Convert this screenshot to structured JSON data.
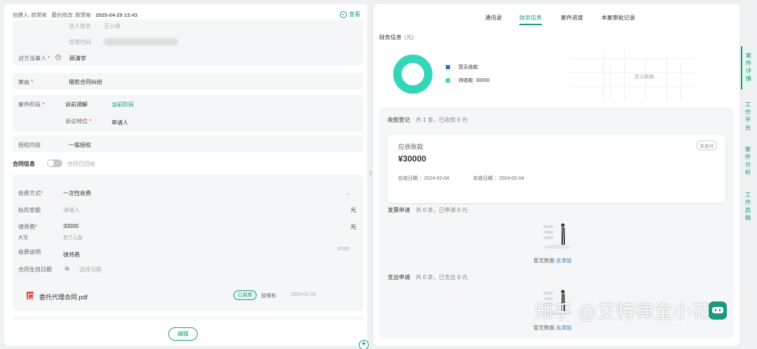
{
  "left": {
    "meta": {
      "creator_label": "创建人:",
      "creator": "欧荣彬",
      "modifier_label": "最后修改:",
      "modifier": "欧荣彬",
      "date": "2025-04-29 13:43"
    },
    "view_label": "查看",
    "fields": {
      "legal_person_label": "法人姓名",
      "legal_person_value": "王小侠",
      "credit_code_label": "信用代码",
      "counterparty_label": "对方当事人",
      "counterparty_value": "顾清宰",
      "cause_label": "案由",
      "cause_value": "借款合同纠纷",
      "stage_label": "案件阶段",
      "stage_value": "诉前调解",
      "stage_link": "当前阶段",
      "position_label": "诉讼地位",
      "position_value": "申请人",
      "auth_label": "授权内容",
      "auth_value": "一般授权"
    },
    "contract": {
      "title": "合同信息",
      "toggle_label": "合同已回收",
      "fee_method_label": "收费方式",
      "fee_method_value": "一次性收费",
      "target_amount_label": "标的金额",
      "target_amount_placeholder": "请输入",
      "unit": "元",
      "lawyer_fee_label": "律师费",
      "lawyer_fee_value": "30000",
      "uppercase_label": "大写",
      "uppercase_value": "叁万元整",
      "fee_note_label": "收费说明",
      "fee_note_value": "律师费",
      "char_count": "3/500",
      "effective_date_label": "合同生效日期",
      "effective_date_placeholder": "选择日期",
      "file_name": "委托代理合同.pdf",
      "file_tag": "已用章",
      "file_user": "欧荣彬",
      "file_date": "2024-01-09"
    },
    "edit_label": "编辑"
  },
  "right": {
    "tabs": [
      "通讯录",
      "财务信息",
      "案件进度",
      "本案审批记录"
    ],
    "active_tab": "财务信息",
    "finance_title": "财务信息",
    "finance_unit": "(元)",
    "legend": [
      {
        "label": "暂无收款",
        "value": "",
        "color": "#1f78c8"
      },
      {
        "label": "待收款",
        "value": "30000",
        "color": "#34d6b8"
      }
    ],
    "no_data": "暂无数据",
    "receipts": {
      "title": "收款登记",
      "summary_pre": "共",
      "count": "1",
      "summary_mid": "条，已收款",
      "amount": "0",
      "summary_post": "元",
      "card": {
        "title": "应收账款",
        "amount": "¥30000",
        "status": "未支付",
        "due_label": "应收日期 ：2024-02-04",
        "actual_label": "实收日期 ：2024-02-04"
      }
    },
    "invoices": {
      "title": "发票申请",
      "summary_pre": "共",
      "count": "0",
      "summary_mid": "条，已申请",
      "amount": "0",
      "summary_post": "元",
      "empty": "暂无数据",
      "add": "去添加"
    },
    "expenses": {
      "title": "支出申请",
      "summary_pre": "共",
      "count": "0",
      "summary_mid": "条，已支出",
      "amount": "0",
      "summary_post": "元",
      "empty": "暂无数据",
      "add": "去添加"
    }
  },
  "side_tabs": [
    "案件详情",
    "工作平台",
    "案件分析",
    "工作底稿"
  ],
  "watermark": "知乎 @艾特律宝小花",
  "colors": {
    "accent": "#1a9a7e",
    "donut": "#34d6b8",
    "required": "#e5484d"
  }
}
